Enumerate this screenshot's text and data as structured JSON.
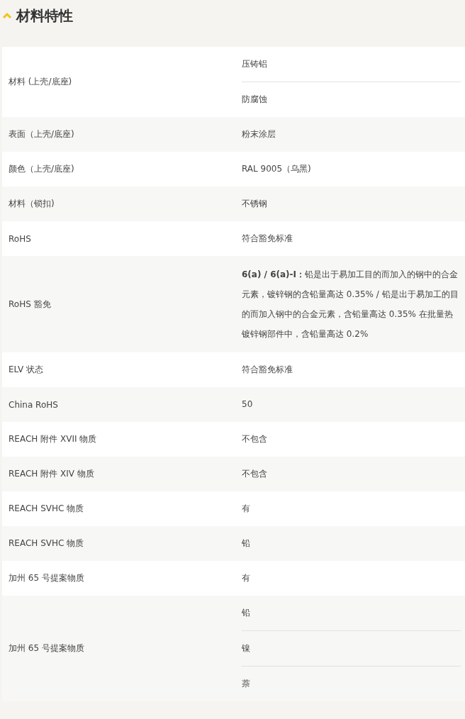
{
  "section": {
    "title": "材料特性",
    "expanded": true
  },
  "rows": [
    {
      "label": "材料 (上壳/底座)",
      "values": [
        "压铸铝",
        "防腐蚀"
      ]
    },
    {
      "label": "表面（上壳/底座)",
      "values": [
        "粉末涂层"
      ]
    },
    {
      "label": "颜色（上壳/底座)",
      "values": [
        "RAL 9005（乌黑)"
      ]
    },
    {
      "label": "材料（锁扣)",
      "values": [
        "不锈钢"
      ]
    },
    {
      "label": "RoHS",
      "values": [
        "符合豁免标准"
      ]
    },
    {
      "label": "RoHS 豁免",
      "values": [
        "**6(a) / 6(a)-I：**铅是出于易加工目的而加入的钢中的合金元素，镀锌钢的含铅量高达 0.35% / 铅是出于易加工的目的而加入钢中的合金元素，含铅量高达 0.35% 在批量热镀锌钢部件中，含铅量高达 0.2%"
      ]
    },
    {
      "label": "ELV 状态",
      "values": [
        "符合豁免标准"
      ]
    },
    {
      "label": "China RoHS",
      "values": [
        "50"
      ]
    },
    {
      "label": "REACH 附件 XVII 物质",
      "values": [
        "不包含"
      ]
    },
    {
      "label": "REACH 附件 XIV 物质",
      "values": [
        "不包含"
      ]
    },
    {
      "label": "REACH SVHC 物质",
      "values": [
        "有"
      ]
    },
    {
      "label": "REACH SVHC 物质",
      "values": [
        "铅"
      ]
    },
    {
      "label": "加州 65 号提案物质",
      "values": [
        "有"
      ]
    },
    {
      "label": "加州 65 号提案物质",
      "values": [
        "铅",
        "镍",
        "萘"
      ]
    }
  ]
}
